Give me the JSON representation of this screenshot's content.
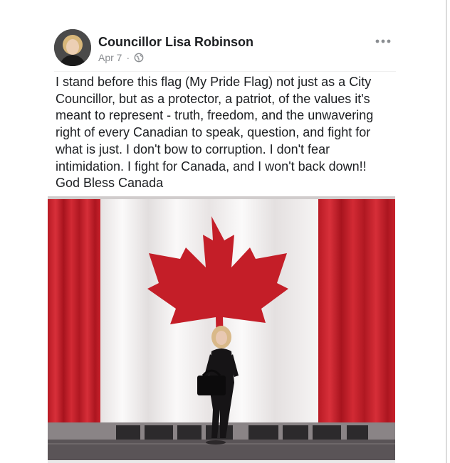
{
  "post": {
    "author": "Councillor Lisa Robinson",
    "date": "Apr 7",
    "separator": "·",
    "privacy_icon": "globe-icon",
    "more_icon": "more-options-icon",
    "text_lines": [
      "I stand before this flag (My Pride Flag) not just as a City",
      "Councillor, but as a protector, a patriot, of the values it's",
      "meant to represent - truth, freedom, and the unwavering",
      "right of every Canadian to speak, question, and fight for",
      "what is just.  I don't bow to corruption.  I don't fear",
      "intimidation. I fight for Canada, and I won't back down!!",
      "God Bless Canada"
    ]
  },
  "photo": {
    "subject": "woman-standing-before-canadian-flag",
    "colors": {
      "flag_red": "#c8202a",
      "flag_white": "#f4f2f2",
      "floor": "#5a5457"
    }
  }
}
